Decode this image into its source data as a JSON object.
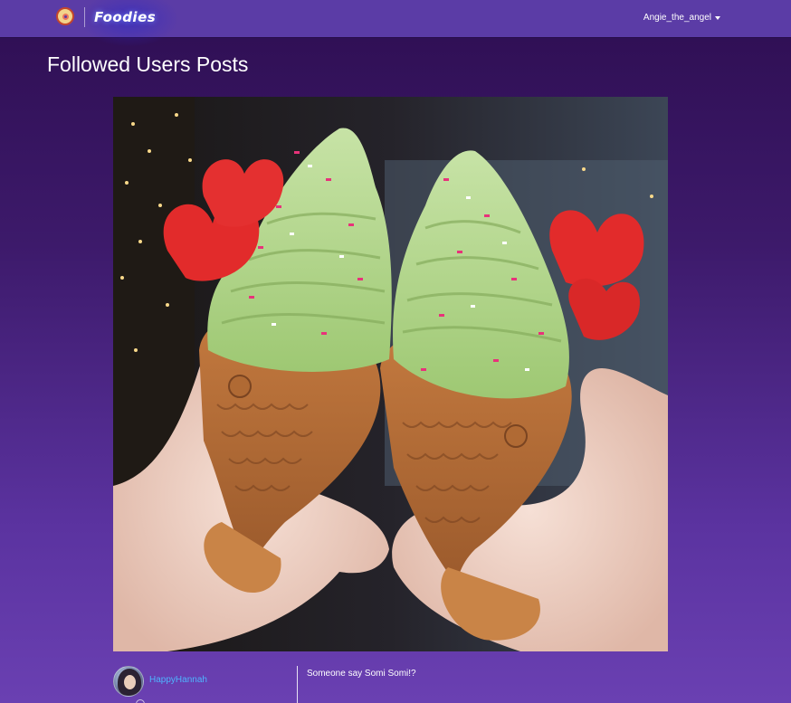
{
  "navbar": {
    "brand": "Foodies",
    "logo_icon": "donut-icon",
    "user_menu_label": "Angie_the_angel",
    "user_menu_icon": "caret-down-icon",
    "accent_color": "#5b3ca6"
  },
  "page": {
    "title": "Followed Users Posts"
  },
  "post": {
    "image_alt": "Two fish-shaped taiyaki cones with green swirl soft serve, heart sprinkles and red heart cookies held by two hands",
    "author": {
      "name": "HappyHannah",
      "avatar_icon": "avatar"
    },
    "caption": "Someone say Somi Somi!?",
    "link_color": "#4fb4ff"
  }
}
